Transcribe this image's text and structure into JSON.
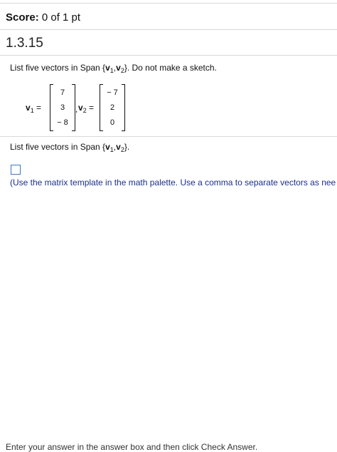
{
  "score": {
    "label": "Score:",
    "value": "0 of 1 pt"
  },
  "question_number": "1.3.15",
  "prompt": {
    "prefix": "List five vectors in Span {",
    "v1": "v",
    "sub1": "1",
    "comma": ",",
    "v2": "v",
    "sub2": "2",
    "suffix": "}. Do not make a sketch."
  },
  "vectors": {
    "v1": {
      "name": "v",
      "sub": "1",
      "eq": " =",
      "entries": [
        "7",
        "3",
        "− 8"
      ],
      "sep": ","
    },
    "v2": {
      "name": "v",
      "sub": "2",
      "eq": " =",
      "entries": [
        "− 7",
        "2",
        "0"
      ]
    }
  },
  "instruction": {
    "prefix": "List five vectors in Span {",
    "v1": "v",
    "sub1": "1",
    "comma": ",",
    "v2": "v",
    "sub2": "2",
    "suffix": "}."
  },
  "hint": "(Use the matrix template in the math palette. Use a comma to separate vectors as nee",
  "footer": "Enter your answer in the answer box and then click Check Answer."
}
